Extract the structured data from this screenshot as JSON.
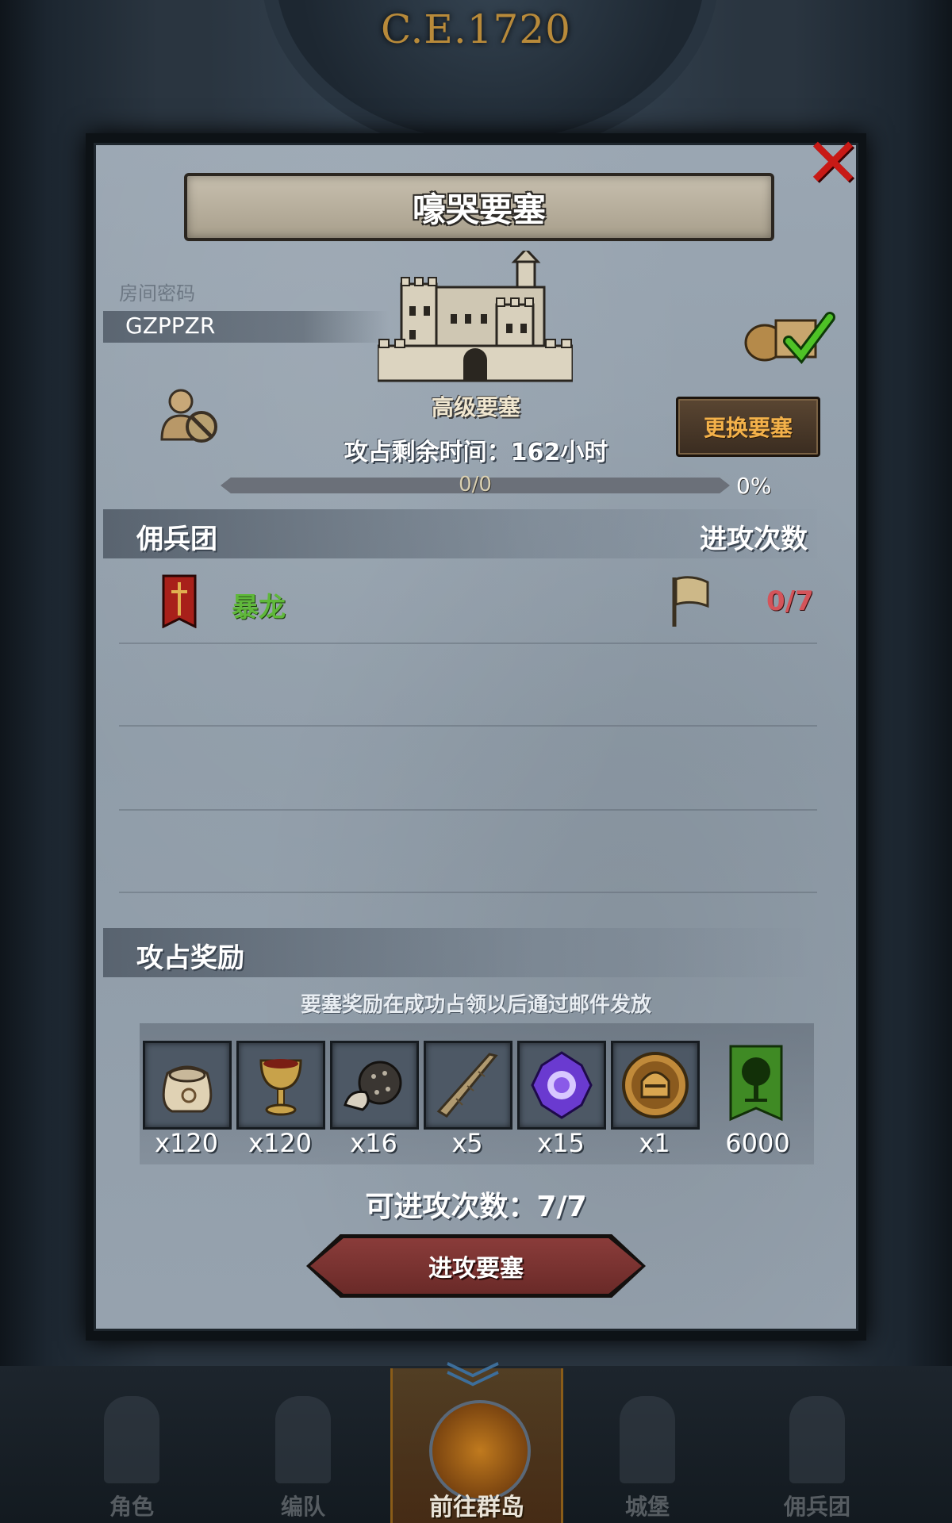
{
  "background": {
    "year_text": "C.E.1720"
  },
  "modal": {
    "title": "嚎哭要塞",
    "close_icon": "close-x-icon",
    "room_password_label": "房间密码",
    "room_password_value": "GZPPZR",
    "fortress_type": "高级要塞",
    "change_fortress_label": "更换要塞",
    "time_remaining": "攻占剩余时间：162小时",
    "progress_text": "0/0",
    "progress_percent_text": "0%",
    "progress_fraction": 0,
    "mercenary_header": "佣兵团",
    "attack_count_header": "进攻次数",
    "guilds": [
      {
        "name": "暴龙",
        "attack_count": "0/7"
      }
    ],
    "reward_header": "攻占奖励",
    "reward_note": "要塞奖励在成功占领以后通过邮件发放",
    "rewards": [
      {
        "icon": "coin-sack-icon",
        "qty": "x120"
      },
      {
        "icon": "goblet-icon",
        "qty": "x120"
      },
      {
        "icon": "ore-rock-icon",
        "qty": "x16"
      },
      {
        "icon": "horn-icon",
        "qty": "x5"
      },
      {
        "icon": "purple-crystal-icon",
        "qty": "x15"
      },
      {
        "icon": "knight-helmet-medal-icon",
        "qty": "x1"
      },
      {
        "icon": "tree-banner-icon",
        "qty": "6000"
      }
    ],
    "available_attacks": "可进攻次数：7/7",
    "attack_button_label": "进攻要塞"
  },
  "bottom_nav": {
    "items": [
      {
        "label": "角色"
      },
      {
        "label": "编队"
      },
      {
        "label": "前往群岛"
      },
      {
        "label": "城堡"
      },
      {
        "label": "佣兵团"
      }
    ]
  },
  "colors": {
    "accent_gold": "#f3b14a",
    "guild_green": "#5fb83a",
    "count_red": "#d4545a",
    "close_red": "#c81a16"
  }
}
